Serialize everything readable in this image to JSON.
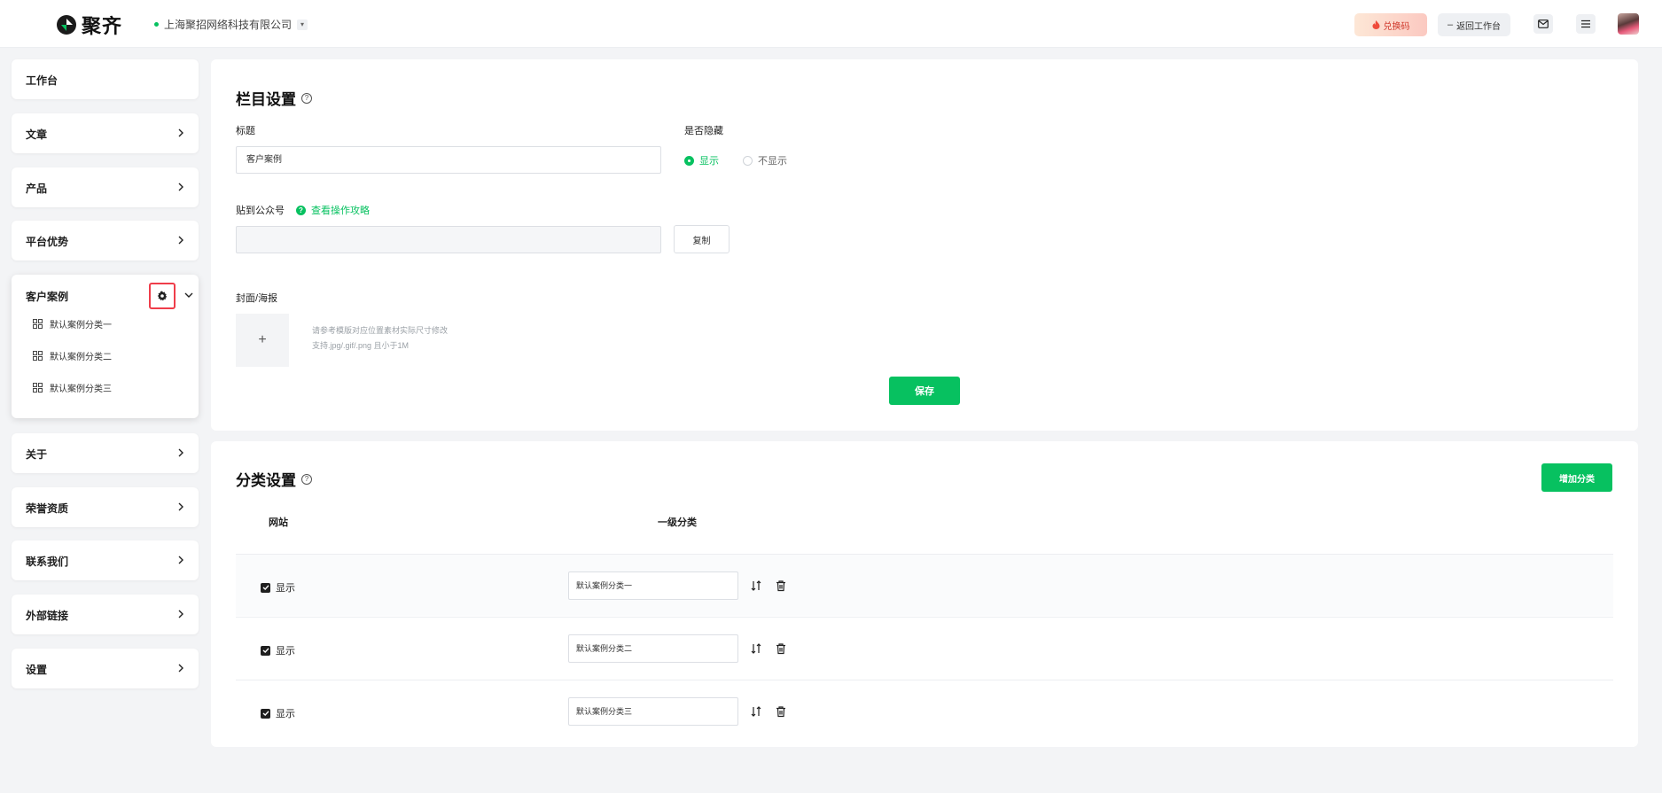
{
  "header": {
    "logo_text": "聚齐",
    "company_name": "上海聚招网络科技有限公司",
    "redeem_label": "兑换码",
    "back_label": "返回工作台",
    "icons": [
      "mail-icon",
      "menu-icon"
    ]
  },
  "sidebar": {
    "items": [
      {
        "label": "工作台"
      },
      {
        "label": "文章"
      },
      {
        "label": "产品"
      },
      {
        "label": "平台优势"
      },
      {
        "label": "客户案例"
      },
      {
        "label": "关于"
      },
      {
        "label": "荣誉资质"
      },
      {
        "label": "联系我们"
      },
      {
        "label": "外部链接"
      },
      {
        "label": "设置"
      }
    ],
    "expanded_sub_items": [
      {
        "label": "默认案例分类一"
      },
      {
        "label": "默认案例分类二"
      },
      {
        "label": "默认案例分类三"
      }
    ]
  },
  "column_settings": {
    "title": "栏目设置",
    "title_label": "标题",
    "title_value": "客户案例",
    "hidden_label": "是否隐藏",
    "show_option": "显示",
    "hide_option": "不显示",
    "selected": "显示",
    "post_label": "贴到公众号",
    "guide_link": "查看操作攻略",
    "post_value": "",
    "copy_label": "复制",
    "cover_label": "封面/海报",
    "upload_symbol": "+",
    "hint_line1": "请参考模版对应位置素材实际尺寸修改",
    "hint_line2": "支持.jpg/.gif/.png 且小于1M",
    "save_label": "保存"
  },
  "category_settings": {
    "title": "分类设置",
    "add_label": "增加分类",
    "col_site": "网站",
    "col_level1": "一级分类",
    "rows": [
      {
        "show_label": "显示",
        "checked": true,
        "name": "默认案例分类一"
      },
      {
        "show_label": "显示",
        "checked": true,
        "name": "默认案例分类二"
      },
      {
        "show_label": "显示",
        "checked": true,
        "name": "默认案例分类三"
      }
    ]
  },
  "colors": {
    "accent": "#07c160",
    "highlight_border": "#ef3d4a"
  }
}
